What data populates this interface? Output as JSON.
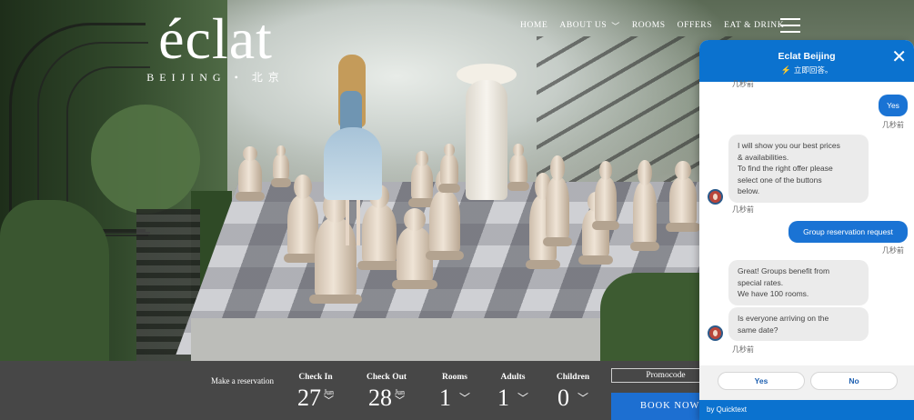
{
  "hero": {
    "logo_main": "éclat",
    "logo_sub": "BEIJING • 北京"
  },
  "nav": {
    "items": [
      "HOME",
      "ABOUT US",
      "ROOMS",
      "OFFERS",
      "EAT & DRINK"
    ]
  },
  "reservation": {
    "label": "Make a reservation",
    "check_in": {
      "head": "Check In",
      "day": "27",
      "month": "Jun"
    },
    "check_out": {
      "head": "Check Out",
      "day": "28",
      "month": "Jun"
    },
    "rooms": {
      "head": "Rooms",
      "value": "1"
    },
    "adults": {
      "head": "Adults",
      "value": "1"
    },
    "children": {
      "head": "Children",
      "value": "0"
    },
    "promocode_label": "Promocode",
    "book_label": "BOOK NOW",
    "accent_color": "#1d6fd1"
  },
  "chat": {
    "title": "Eclat Beijing",
    "status": "立即回答。",
    "accent_color": "#0b72cf",
    "timestamps": [
      "几秒前",
      "几秒前",
      "几秒前",
      "几秒前",
      "几秒前"
    ],
    "messages": [
      {
        "from": "user",
        "text": "Yes"
      },
      {
        "from": "bot",
        "lines": [
          "I will show you our best prices",
          "& availabilities.",
          "To find the right offer please",
          "select one of the buttons",
          "below."
        ]
      },
      {
        "from": "user",
        "text": "Group reservation request"
      },
      {
        "from": "bot",
        "lines": [
          "Great! Groups benefit from",
          "special rates.",
          "We have 100 rooms."
        ]
      },
      {
        "from": "bot",
        "lines": [
          "Is everyone arriving on the",
          "same date?"
        ]
      }
    ],
    "quick_replies": [
      "Yes",
      "No"
    ],
    "footer": "by Quicktext"
  }
}
